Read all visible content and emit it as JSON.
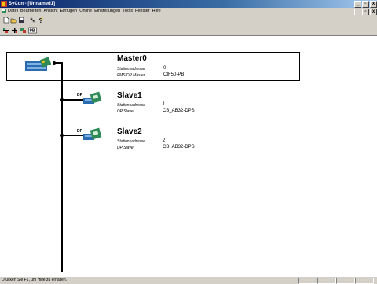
{
  "window": {
    "title": "SyCon - [Unnamed1]"
  },
  "menu": [
    "Datei",
    "Bearbeiten",
    "Ansicht",
    "Einfügen",
    "Online",
    "Einstellungen",
    "Tools",
    "Fenster",
    "Hilfe"
  ],
  "window_buttons": {
    "min": "_",
    "max": "▫",
    "close": "x"
  },
  "toolbar1_icons": [
    "new-file-icon",
    "open-folder-icon",
    "save-icon",
    "network-icon",
    "help-icon"
  ],
  "toolbar2_icons": [
    "insert-master-icon",
    "insert-slave-icon",
    "connect-icon",
    "pb-icon"
  ],
  "toolbar2_pb_label": "PB",
  "nodes": {
    "master": {
      "name": "Master0",
      "addr_label": "Stationsadresse",
      "addr_value": "0",
      "type_label": "FMS/DP Master",
      "type_value": "CIF50-PB"
    },
    "slave1": {
      "name": "Slave1",
      "addr_label": "Stationsadresse",
      "addr_value": "1",
      "type_label": "DP Slave",
      "type_value": "CB_AB32-DPS",
      "badge": "DP"
    },
    "slave2": {
      "name": "Slave2",
      "addr_label": "Stationsadresse",
      "addr_value": "2",
      "type_label": "DP Slave",
      "type_value": "CB_AB32-DPS",
      "badge": "DP"
    }
  },
  "status": {
    "message": "Drücken Sie F1, um Hilfe zu erhalten."
  }
}
